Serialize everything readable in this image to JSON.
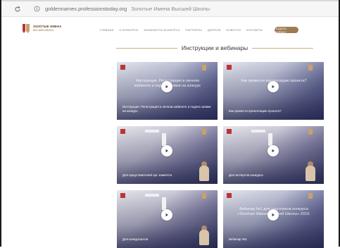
{
  "browser": {
    "url": "goldennames.professionstoday.org",
    "tab_title": "Золотые Имена Высшей Школы"
  },
  "site": {
    "logo_line1": "ЗОЛОТЫЕ ИМЕНА",
    "logo_line2": "ВЫСШЕЙ ШКОЛЫ",
    "nav": [
      {
        "label": "ГЛАВНАЯ"
      },
      {
        "label": "О КОНКУРСЕ"
      },
      {
        "label": "ФИНАЛИСТЫ КОНКУРСА"
      },
      {
        "label": "ПАРТНЕРЫ"
      },
      {
        "label": "ДИПЛОМ"
      },
      {
        "label": "НОВОСТИ"
      },
      {
        "label": "КОНТАКТЫ"
      }
    ],
    "cta_label": "ПОДАТЬ ЗАЯВКУ"
  },
  "section": {
    "title": "Инструкции и вебинары"
  },
  "cards": [
    {
      "faint_title": "Инструкция. Регистрация в личном кабинете и подача заявки на конкурс",
      "caption": "Инструкция. Регистрация в личном кабинете и подача заявки на конкурс."
    },
    {
      "faint_title": "Как провести презентацию проекта?",
      "caption": "Как провести презентацию проекта?"
    },
    {
      "faint_title": "",
      "caption": "Для представителей орг. комитета"
    },
    {
      "faint_title": "",
      "caption": "Для экспертов конкурса"
    },
    {
      "faint_title": "",
      "caption": "Для конкурсантов"
    },
    {
      "faint_title": "Вебинар №1 для участников конкурса «Золотые Имена Высшей Школы» 2019.",
      "caption": "Вебинар №1"
    }
  ],
  "colors": {
    "accent_gold": "#9e7b52",
    "title_line": "#cfae7f",
    "card_overlay": "#3d4170"
  }
}
